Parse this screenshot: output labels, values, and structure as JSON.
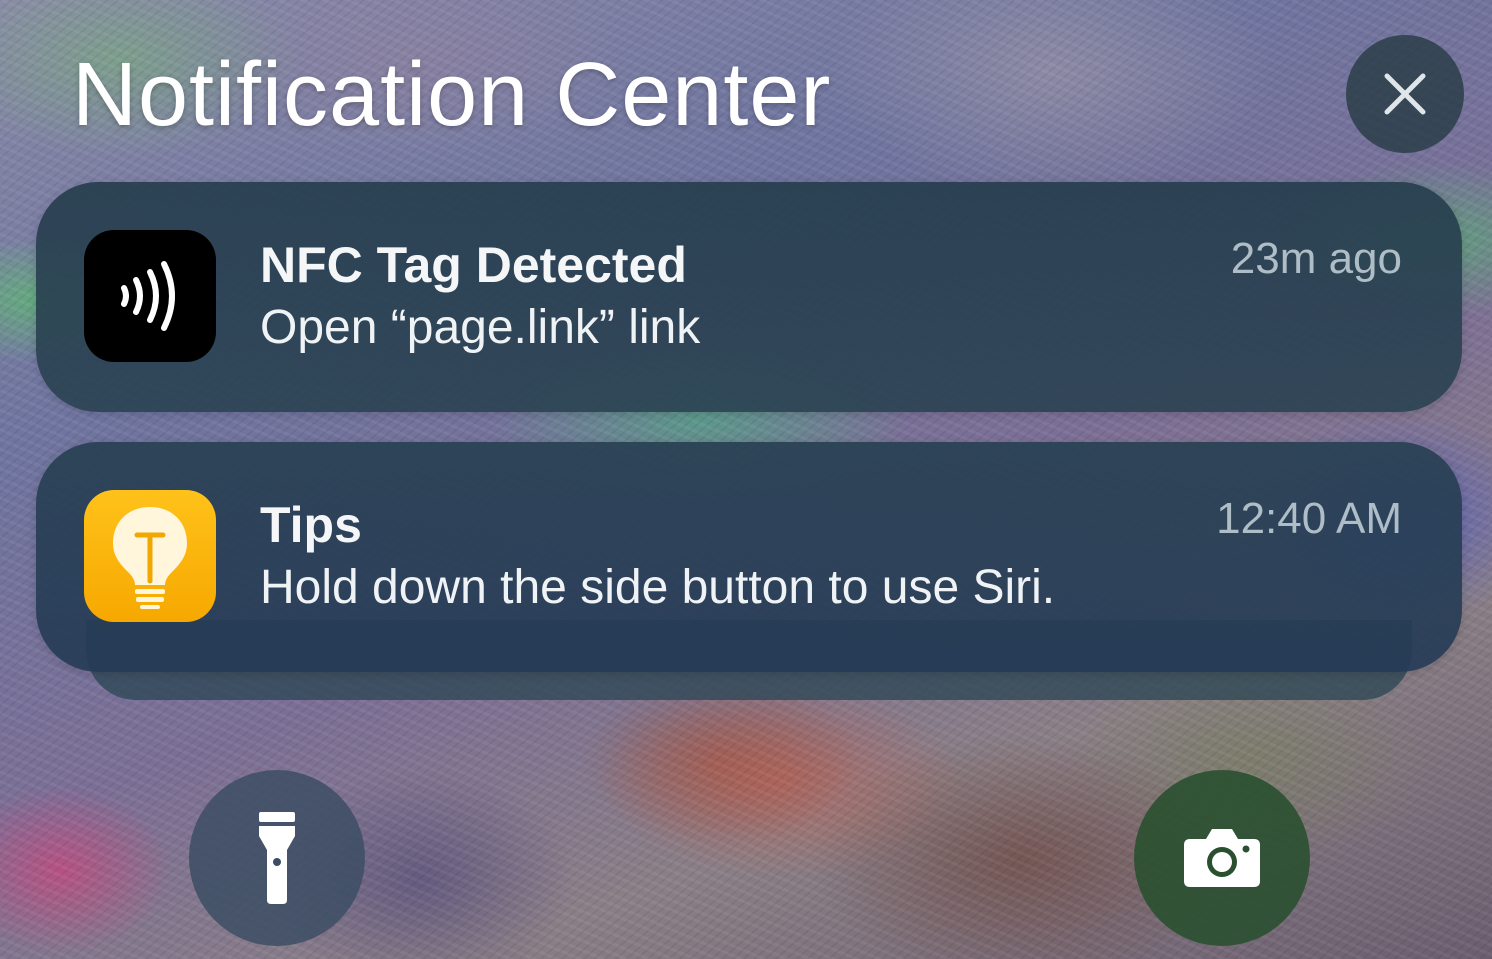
{
  "header": {
    "title": "Notification Center",
    "close_icon": "close-icon"
  },
  "notifications": [
    {
      "app_icon": "nfc-icon",
      "title": "NFC Tag Detected",
      "body": "Open “page.link” link",
      "time": "23m ago",
      "icon_color": "#000000"
    },
    {
      "app_icon": "lightbulb-icon",
      "title": "Tips",
      "body": "Hold down the side button to use Siri.",
      "time": "12:40 AM",
      "icon_color": "#ffc21a"
    }
  ],
  "quick_actions": {
    "flashlight_icon": "flashlight-icon",
    "camera_icon": "camera-icon"
  }
}
